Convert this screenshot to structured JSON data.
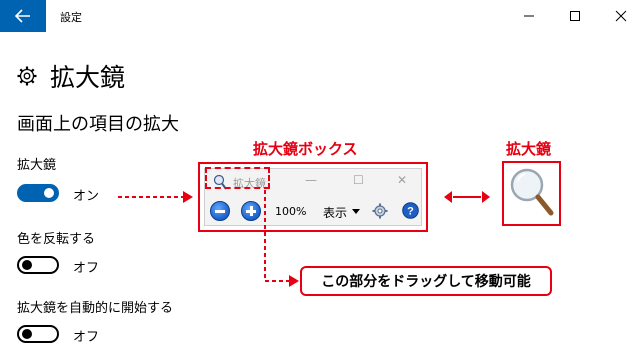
{
  "window": {
    "title": "設定",
    "back_icon": "back-arrow-icon",
    "controls": [
      "minimize-icon",
      "maximize-icon",
      "close-icon"
    ]
  },
  "page": {
    "icon": "gear-icon",
    "title": "拡大鏡",
    "section_title": "画面上の項目の拡大"
  },
  "settings": [
    {
      "label": "拡大鏡",
      "state": "オン",
      "on": true
    },
    {
      "label": "色を反転する",
      "state": "オフ",
      "on": false
    },
    {
      "label": "拡大鏡を自動的に開始する",
      "state": "オフ",
      "on": false
    }
  ],
  "magnifier_window": {
    "title": "拡大鏡",
    "zoom": "100%",
    "view_menu": "表示",
    "minimize_glyph": "—",
    "maximize_glyph": "☐",
    "close_glyph": "✕"
  },
  "annotations": {
    "box_label": "拡大鏡ボックス",
    "icon_label": "拡大鏡",
    "drag_note": "この部分をドラッグして移動可能"
  },
  "colors": {
    "accent": "#0063b1",
    "annotation_red": "#e60012"
  }
}
